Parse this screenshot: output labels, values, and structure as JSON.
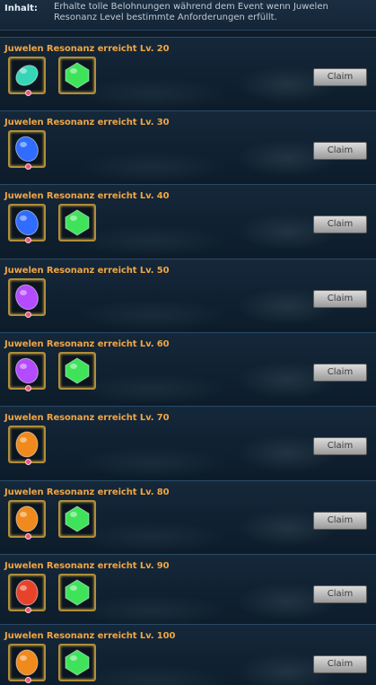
{
  "header": {
    "label": "Inhalt:",
    "description": "Erhalte tolle Belohnungen während dem Event wenn Juwelen Resonanz Level bestimmte Anforderungen erfüllt."
  },
  "rows": [
    {
      "title": "Juwelen Resonanz erreicht Lv. 20",
      "claim": "Claim",
      "items": [
        "teal-gem",
        "green-gem"
      ]
    },
    {
      "title": "Juwelen Resonanz erreicht Lv. 30",
      "claim": "Claim",
      "items": [
        "blue-gem"
      ]
    },
    {
      "title": "Juwelen Resonanz erreicht Lv. 40",
      "claim": "Claim",
      "items": [
        "blue-gem",
        "green-gem"
      ]
    },
    {
      "title": "Juwelen Resonanz erreicht Lv. 50",
      "claim": "Claim",
      "items": [
        "purple-gem"
      ]
    },
    {
      "title": "Juwelen Resonanz erreicht Lv. 60",
      "claim": "Claim",
      "items": [
        "purple-gem",
        "green-gem"
      ]
    },
    {
      "title": "Juwelen Resonanz erreicht Lv. 70",
      "claim": "Claim",
      "items": [
        "orange-gem"
      ]
    },
    {
      "title": "Juwelen Resonanz erreicht Lv. 80",
      "claim": "Claim",
      "items": [
        "orange-gem",
        "green-gem"
      ]
    },
    {
      "title": "Juwelen Resonanz erreicht Lv. 90",
      "claim": "Claim",
      "items": [
        "red-gem",
        "green-gem"
      ]
    },
    {
      "title": "Juwelen Resonanz erreicht Lv. 100",
      "claim": "Claim",
      "items": [
        "orange-gem",
        "green-gem"
      ]
    }
  ],
  "colors": {
    "title": "#f0a544",
    "teal-gem": "#35d6b8",
    "green-gem": "#3fe35a",
    "blue-gem": "#2f6cff",
    "purple-gem": "#b44bff",
    "orange-gem": "#f08a1c",
    "red-gem": "#e8432a"
  }
}
